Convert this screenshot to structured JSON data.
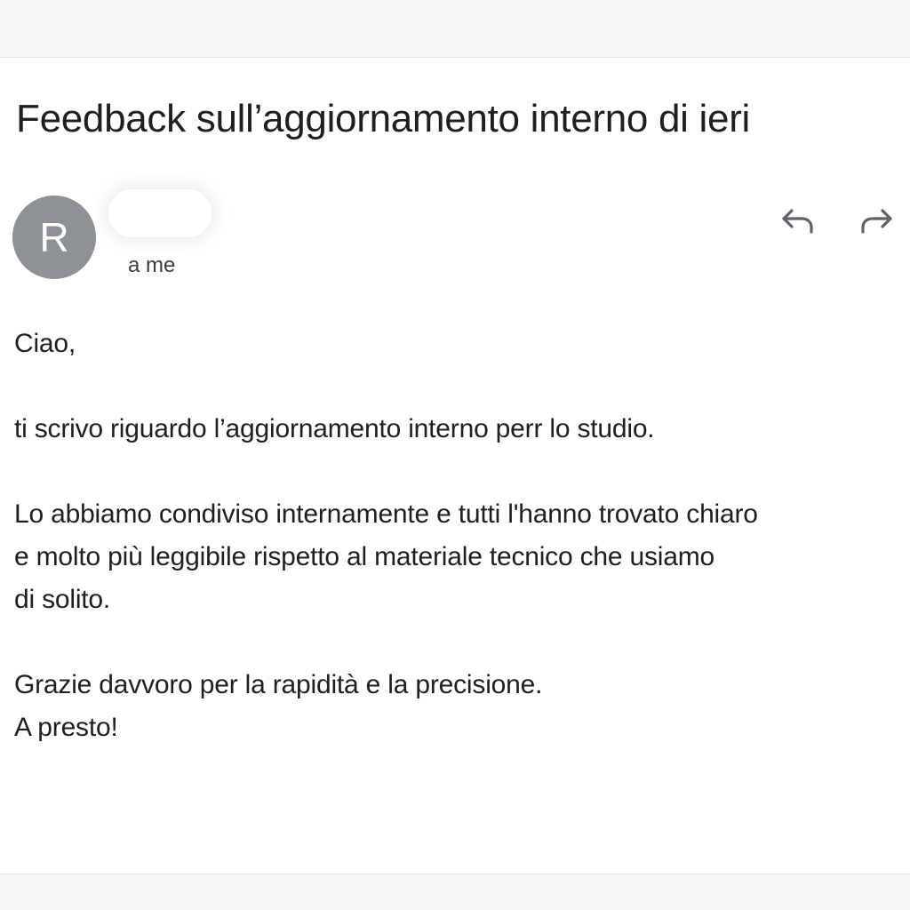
{
  "email": {
    "subject": "Feedback sull’aggiornamento interno di ieri",
    "sender": {
      "initial": "R",
      "name": "",
      "recipient_line": "a me"
    },
    "actions": {
      "reply_icon": "reply-icon",
      "forward_icon": "forward-icon"
    },
    "body": {
      "greeting": "Ciao,",
      "paragraph_1": "ti scrivo riguardo l’aggiornamento interno perr lo studio.",
      "paragraph_2_line_1": "Lo abbiamo condiviso internamente e tutti l'hanno trovato chiaro",
      "paragraph_2_line_2": "e molto più leggibile rispetto al materiale tecnico che usiamo",
      "paragraph_2_line_3": "di solito.",
      "closing_line_1": "Grazie davvoro per la rapidità e la  precisione.",
      "closing_line_2": "A presto!"
    }
  },
  "colors": {
    "avatar": "#8e9194",
    "text": "#1f1f1f",
    "icon": "#5f6368"
  }
}
